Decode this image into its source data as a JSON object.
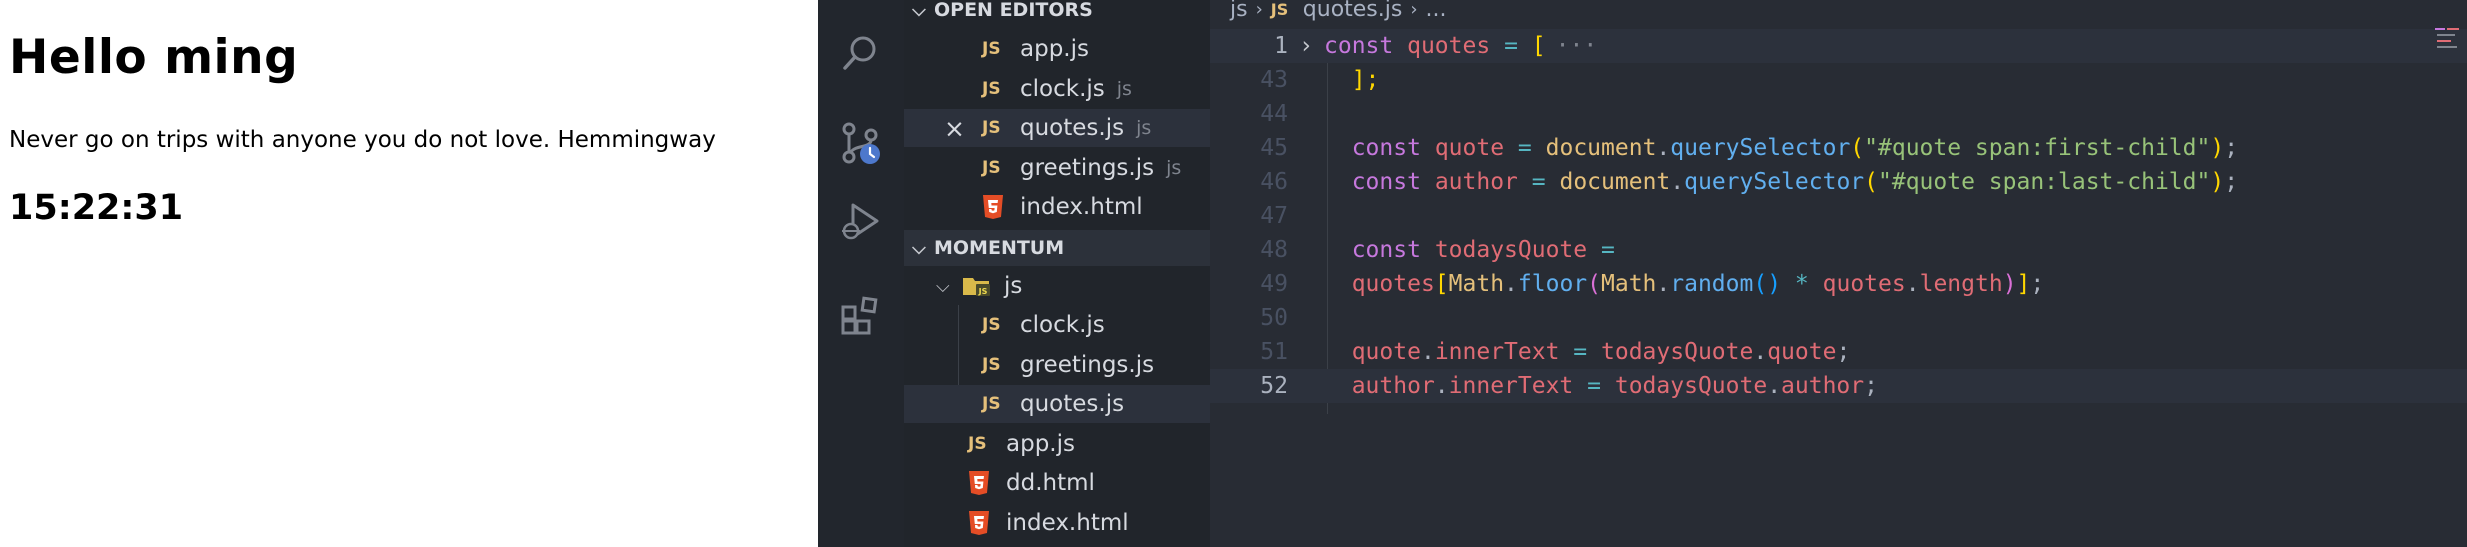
{
  "preview": {
    "title": "Hello ming",
    "quote": "Never go on trips with anyone you do not love. Hemmingway",
    "clock": "15:22:31"
  },
  "activity_bar": {
    "icons": [
      "search-icon",
      "source-control-icon",
      "run-debug-icon",
      "extensions-icon"
    ]
  },
  "sidebar": {
    "open_editors_header": "OPEN EDITORS",
    "open_editors": [
      {
        "badge": "JS",
        "name": "app.js",
        "dir": ""
      },
      {
        "badge": "JS",
        "name": "clock.js",
        "dir": "js"
      },
      {
        "badge": "JS",
        "name": "quotes.js",
        "dir": "js",
        "close": "×"
      },
      {
        "badge": "JS",
        "name": "greetings.js",
        "dir": "js"
      },
      {
        "badge": "html",
        "name": "index.html",
        "dir": ""
      }
    ],
    "workspace_header": "MOMENTUM",
    "tree": [
      {
        "type": "folder",
        "name": "js"
      },
      {
        "badge": "JS",
        "name": "clock.js"
      },
      {
        "badge": "JS",
        "name": "greetings.js"
      },
      {
        "badge": "JS",
        "name": "quotes.js"
      },
      {
        "badge": "JS",
        "name": "app.js"
      },
      {
        "badge": "html",
        "name": "dd.html"
      },
      {
        "badge": "html",
        "name": "index.html"
      }
    ]
  },
  "editor": {
    "breadcrumb": {
      "folder": "js",
      "badge": "JS",
      "file": "quotes.js",
      "tail": "..."
    },
    "line_numbers": [
      "1",
      "43",
      "44",
      "45",
      "46",
      "47",
      "48",
      "49",
      "50",
      "51",
      "52"
    ],
    "fold_ellipsis": "···",
    "code": {
      "l1_kw": "const",
      "l1_var": "quotes",
      "l1_op": "=",
      "l1_br": "[",
      "l43": "];",
      "l45_kw": "const",
      "l45_var": "quote",
      "l45_obj": "document",
      "l45_fn": "querySelector",
      "l45_str": "\"#quote span:first-child\"",
      "l46_kw": "const",
      "l46_var": "author",
      "l46_obj": "document",
      "l46_fn": "querySelector",
      "l46_str": "\"#quote span:last-child\"",
      "l48_kw": "const",
      "l48_var": "todaysQuote",
      "l49_var": "quotes",
      "l49_math1": "Math",
      "l49_floor": "floor",
      "l49_math2": "Math",
      "l49_random": "random",
      "l49_var2": "quotes",
      "l49_len": "length",
      "l51_var": "quote",
      "l51_prop": "innerText",
      "l51_var2": "todaysQuote",
      "l51_prop2": "quote",
      "l52_var": "author",
      "l52_prop": "innerText",
      "l52_var2": "todaysQuote",
      "l52_prop2": "author"
    }
  },
  "colors": {
    "editor_bg": "#282c34",
    "sidebar_bg": "#21252b",
    "js_badge": "#e5c07b",
    "html_badge": "#e44d26",
    "keyword": "#c678dd",
    "variable": "#e06c75",
    "function": "#61afef",
    "string": "#98c379"
  }
}
